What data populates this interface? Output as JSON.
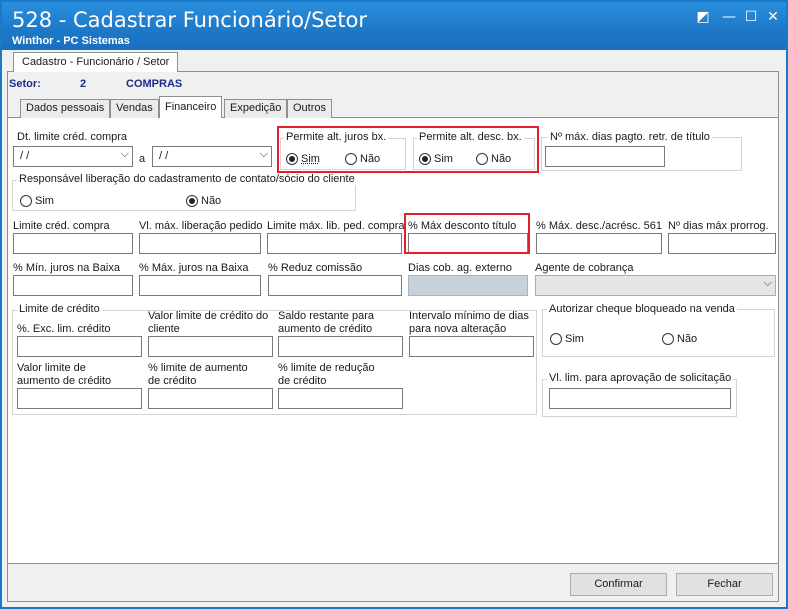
{
  "window": {
    "title": "528 - Cadastrar Funcionário/Setor",
    "subtitle": "Winthor - PC Sistemas",
    "controls": {
      "restore_icon": "◩",
      "minimize_icon": "—",
      "maximize_icon": "☐",
      "close_icon": "✕"
    }
  },
  "outer_tab": "Cadastro - Funcionário / Setor",
  "setor": {
    "label": "Setor:",
    "number": "2",
    "name": "COMPRAS"
  },
  "tabs": [
    "Dados pessoais",
    "Vendas",
    "Financeiro",
    "Expedição",
    "Outros"
  ],
  "active_tab": "Financeiro",
  "financeiro": {
    "dt_limite": {
      "label": "Dt.  limite créd. compra",
      "from": "/ /",
      "sep": "a",
      "to": "/ /"
    },
    "juros": {
      "label": "Permite alt. juros bx.",
      "sim": "Sim",
      "nao": "Não",
      "selected": "Sim"
    },
    "desc": {
      "label": "Permite alt. desc. bx.",
      "sim": "Sim",
      "nao": "Não",
      "selected": "Sim"
    },
    "max_dias_label": "Nº máx. dias pagto. retr. de título",
    "responsavel": {
      "label": "Responsável liberação do cadastramento de contato/sócio do cliente",
      "sim": "Sim",
      "nao": "Não",
      "selected": "Não"
    },
    "row1_labels": [
      "Limite créd. compra",
      "Vl. máx. liberação pedido",
      "Limite máx. lib. ped. compra",
      "% Máx desconto título",
      "% Máx. desc./acrésc. 561",
      "Nº dias máx prorrog."
    ],
    "row2_labels": [
      "% Mín. juros na Baixa",
      "% Máx. juros na Baixa",
      "% Reduz  comissão",
      "Dias cob. ag. externo",
      "Agente de cobrança"
    ],
    "limite_credito": {
      "title": "Limite de crédito",
      "labels": [
        "%. Exc. lim. crédito",
        "Valor limite de crédito do cliente",
        "Saldo restante para aumento de crédito",
        "Intervalo mínimo de dias para nova alteração",
        "Valor limite de aumento de crédito",
        "% limite de aumento de crédito",
        "% limite de redução de crédito"
      ]
    },
    "cheque": {
      "label": "Autorizar cheque bloqueado na venda",
      "sim": "Sim",
      "nao": "Não"
    },
    "vl_lim_label": "Vl. lim. para aprovação de solicitação"
  },
  "buttons": {
    "confirmar": "Confirmar",
    "fechar": "Fechar"
  },
  "colors": {
    "titlebar": "#1d78c8",
    "highlight": "#e0202a",
    "setor_text": "#1e2c8c"
  }
}
